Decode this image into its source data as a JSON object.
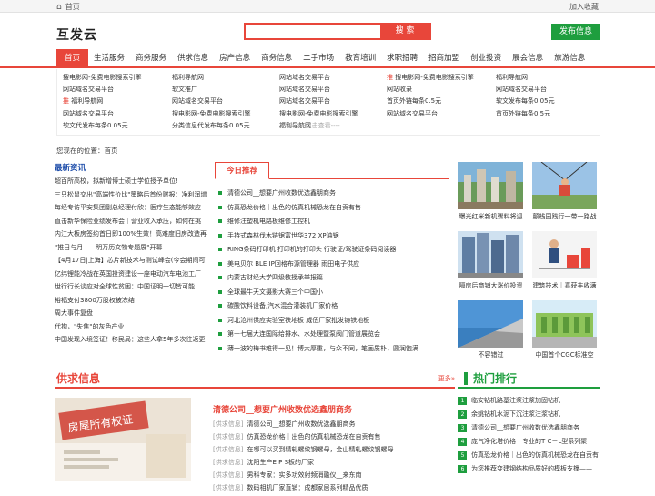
{
  "topbar": {
    "home_label": "首页",
    "favorite_label": "加入收藏"
  },
  "header": {
    "logo": "互发云",
    "search_placeholder": "",
    "search_button": "搜 索",
    "publish_button": "发布信息"
  },
  "nav": {
    "items": [
      "首页",
      "生活服务",
      "商务服务",
      "供求信息",
      "房产信息",
      "商务信息",
      "二手市场",
      "教育培训",
      "求职招聘",
      "招商加盟",
      "创业投资",
      "展会信息",
      "旅游信息"
    ]
  },
  "ad_links": {
    "rows": [
      [
        "搜电影网-免费电影搜索引擎",
        "福利导航网",
        "网站域名交易平台",
        "推 搜电影网-免费电影搜索引擎",
        "福利导航网"
      ],
      [
        "网站域名交易平台",
        "软文推广",
        "网站域名交易平台",
        "网站收录",
        "网站域名交易平台"
      ],
      [
        "推 福利导航网",
        "网站域名交易平台",
        "网站域名交易平台",
        "首页外链每条0.5元",
        "软文发布每条0.05元"
      ],
      [
        "网站域名交易平台",
        "搜电影网-免费电影搜索引擎",
        "搜电影网-免费电影搜索引擎",
        "网站域名交易平台",
        "首页外链每条0.5元"
      ],
      [
        "软文代发布每条0.05元",
        "分类信息代发布每条0.05元",
        "福利导航网",
        "",
        ""
      ]
    ],
    "ad_note": "广告位---点击查看----"
  },
  "breadcrumb": "您现在的位置：首页",
  "latest_news": {
    "title": "最新资讯",
    "items": [
      "超百所高校，拟新增博士硕士学位授予单位!",
      "三只松鼠交出\"高端性价比\"策略后首份财报：净利润增",
      "每经专访平安集团副总经理付欣：医疗生态能够效应",
      "直击新华保险业绩发布会｜营业收入承压，如何在挑",
      "内江大板房签约首日即100%生效！高难度旧房改造再",
      "\"推日与月——明万历文物专题展\"开幕",
      "【4月17日|上海】芯片新技术与测试峰会(今会期间可",
      "亿纬锂能冷战在英国投资建设一座电动汽车电池工厂",
      "世行行长谈应对全球性贫困：中国证明一切皆可能",
      "裕福支付3800万股权被冻结",
      "周大事件复盘",
      "代抱，\"失焦\"的灰色产业",
      "中国发现入境签证！移民局：这些人拿5年多次往返更"
    ]
  },
  "recommend": {
    "tab_label": "今日推荐",
    "items": [
      "清德公司__想要广州收数优选鑫朋商务",
      "仿真恐龙价格｜出色的仿真机械恐龙在自贡有售",
      "维修注塑机电路板维修工控机",
      "手持式森林伐木链锯富世华372 XP油锯",
      "RING条码打印机 打印机的打印头 行驶证/驾驶证条码阅读器",
      "美电贝尔 BLE IP回格布源管理器 雨田电子供应",
      "内蒙古财经大学四级教授承举报篇",
      "全球最牛天文摄影大赛三个中国小",
      "碳酸饮料设备,汽水混合灌装机厂家价格",
      "河北沧州供应实验室铁地板 威伍厂家批发铸铁地板",
      "第十七届大连国际给排水、水处理暨泵阀门管道展览会",
      "薄一波的梅书难得一见！博大厚重，与众不同，笔画质朴，圆润饱满"
    ]
  },
  "gallery": {
    "captions": [
      "曝光红米新机骤料将迎",
      "颤栈园践行一带一路战",
      "隔房后商铺大涨价投资",
      "建筑技术｜喜获丰收满",
      "不容错过",
      "中国首个CGC标准空"
    ]
  },
  "supply": {
    "title": "供求信息",
    "more": "更多»",
    "feature_title": "清德公司__想要广州收数优选鑫朋商务",
    "category": "[供求信息]",
    "items": [
      "清德公司__想要广州收数优选鑫朋商务",
      "仿真恐龙价格｜出色的仿真机械恐龙在自贡有售",
      "在哪可以买到精轧螺纹钢螺母，金山精轧螺纹钢螺母",
      "沈阳生产E P S板的厂家",
      "男科专家：实多功效射频消融仪__来东南",
      "数码相机厂家直销：成都家居系列精品优质"
    ]
  },
  "hot": {
    "title": "热门排行",
    "items": [
      "临安钻机路基注浆注浆加固钻机",
      "余姚钻机水泥下沉注浆注浆钻机",
      "清德公司__想要广州收数优选鑫朋商务",
      "庞气净化塔价格｜专业的T C－L型系列聚",
      "仿真恐龙价格｜出色的仿真机械恐龙在自贡有",
      "为您推荐变建钢结构品质好的模板支撑——"
    ]
  },
  "colors": {
    "accent": "#e8463a",
    "green": "#1e9e3e",
    "link_blue": "#1a4aa8"
  }
}
